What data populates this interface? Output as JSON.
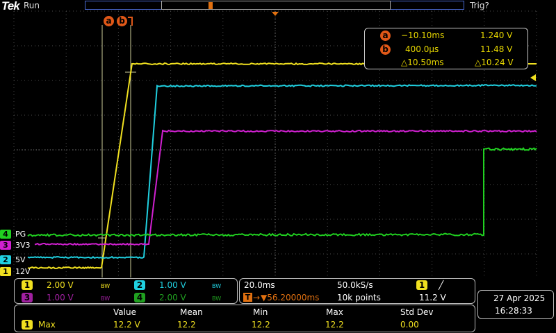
{
  "header": {
    "brand": "Tek",
    "acq_state": "Run",
    "trigger_state": "Trig?"
  },
  "cursors": {
    "a_label": "a",
    "b_label": "b",
    "a_time": "−10.10ms",
    "a_volt": "1.240 V",
    "b_time": "400.0µs",
    "b_volt": "11.48 V",
    "delta_time": "△10.50ms",
    "delta_volt": "△10.24 V"
  },
  "channels": [
    {
      "num": "1",
      "name": "12V",
      "scale": "2.00 V",
      "bw": "BW",
      "color": "#f0e020"
    },
    {
      "num": "2",
      "name": "5V",
      "scale": "1.00 V",
      "bw": "BW",
      "color": "#20d0e0"
    },
    {
      "num": "3",
      "name": "3V3",
      "scale": "1.00 V",
      "bw": "BW",
      "color": "#d020d0"
    },
    {
      "num": "4",
      "name": "PG",
      "scale": "2.00 V",
      "bw": "BW",
      "color": "#20d020"
    }
  ],
  "timebase": {
    "scale": "20.0ms",
    "sample_rate": "50.0kS/s",
    "trigger_pos": "▼56.20000ms",
    "record_length": "10k points",
    "trigger_source": "1",
    "trigger_slope": "╱",
    "trigger_level": "11.2 V"
  },
  "datetime": {
    "date": "27 Apr  2025",
    "time": "16:28:33"
  },
  "measurements": {
    "headers": [
      "Value",
      "Mean",
      "Min",
      "Max",
      "Std Dev"
    ],
    "rows": [
      {
        "source": "1",
        "name": "Max",
        "value": "12.2 V",
        "mean": "12.2",
        "min": "12.2",
        "max": "12.2",
        "std": "0.00"
      }
    ]
  },
  "colors": {
    "ch1": "#f0e020",
    "ch2": "#20d0e0",
    "ch3": "#d020d0",
    "ch4": "#20d020",
    "cursor": "#e05818",
    "grid": "#555555"
  },
  "waveform_levels_volts": {
    "ch1_high": 12.2,
    "ch4_high": 5.0
  }
}
